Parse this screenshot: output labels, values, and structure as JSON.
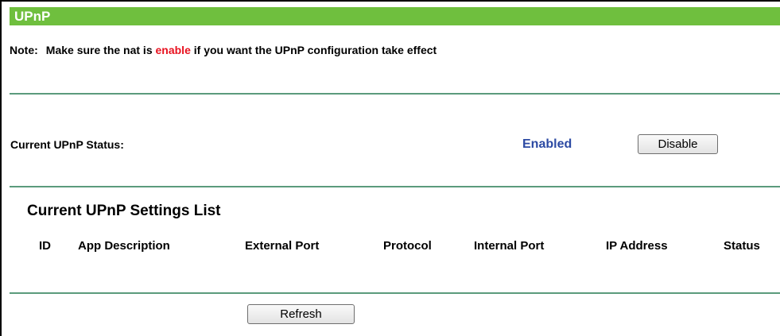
{
  "section": {
    "title": "UPnP"
  },
  "note": {
    "label": "Note:",
    "text_before": "Make sure the nat is ",
    "highlight": "enable",
    "text_after": " if you want the UPnP configuration take effect"
  },
  "status": {
    "label": "Current UPnP Status:",
    "value": "Enabled",
    "toggle_button": "Disable"
  },
  "settings_list": {
    "title": "Current UPnP Settings List",
    "columns": [
      "ID",
      "App Description",
      "External Port",
      "Protocol",
      "Internal Port",
      "IP Address",
      "Status"
    ],
    "rows": []
  },
  "actions": {
    "refresh_button": "Refresh"
  },
  "colors": {
    "title_bar": "#6fbf3e",
    "highlight": "#e8111f",
    "status_value": "#2c4aa3",
    "rule": "#5b9b7c"
  }
}
